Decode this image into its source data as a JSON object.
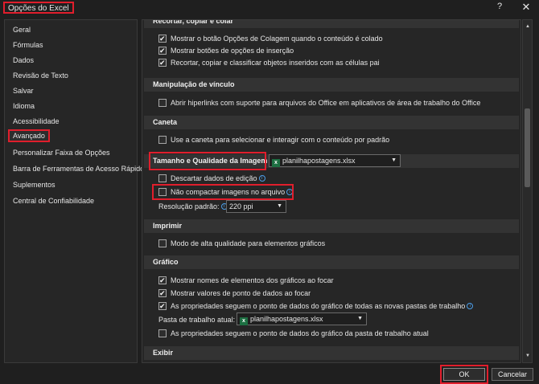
{
  "window": {
    "title": "Opções do Excel",
    "help_label": "?",
    "close_label": "✕"
  },
  "sidebar": {
    "items": [
      {
        "label": "Geral"
      },
      {
        "label": "Fórmulas"
      },
      {
        "label": "Dados"
      },
      {
        "label": "Revisão de Texto"
      },
      {
        "label": "Salvar"
      },
      {
        "label": "Idioma"
      },
      {
        "label": "Acessibilidade"
      },
      {
        "label": "Avançado"
      },
      {
        "label": "Personalizar Faixa de Opções"
      },
      {
        "label": "Barra de Ferramentas de Acesso Rápido"
      },
      {
        "label": "Suplementos"
      },
      {
        "label": "Central de Confiabilidade"
      }
    ],
    "active": "Avançado"
  },
  "content": {
    "cut_section": {
      "header": "Recortar, copiar e colar",
      "options": [
        {
          "label": "Mostrar o botão Opções de Colagem quando o conteúdo é colado",
          "checked": true
        },
        {
          "label": "Mostrar botões de opções de inserção",
          "checked": true
        },
        {
          "label": "Recortar, copiar e classificar objetos inseridos com as células pai",
          "checked": true
        }
      ]
    },
    "link_section": {
      "header": "Manipulação de vínculo",
      "options": [
        {
          "label": "Abrir hiperlinks com suporte para arquivos do Office em aplicativos de área de trabalho do Office",
          "checked": false
        }
      ]
    },
    "pen_section": {
      "header": "Caneta",
      "options": [
        {
          "label": "Use a caneta para selecionar e interagir com o conteúdo por padrão",
          "checked": false
        }
      ]
    },
    "image_section": {
      "header": "Tamanho e Qualidade da Imagem",
      "file_select": "planilhapostagens.xlsx",
      "options": [
        {
          "label": "Descartar dados de edição",
          "checked": false
        },
        {
          "label": "Não compactar imagens no arquivo",
          "checked": false
        }
      ],
      "resolution_label": "Resolução padrão:",
      "resolution_value": "220 ppi"
    },
    "print_section": {
      "header": "Imprimir",
      "options": [
        {
          "label": "Modo de alta qualidade para elementos gráficos",
          "checked": false
        }
      ]
    },
    "chart_section": {
      "header": "Gráfico",
      "options": [
        {
          "label": "Mostrar nomes de elementos dos gráficos ao focar",
          "checked": true
        },
        {
          "label": "Mostrar valores de ponto de dados ao focar",
          "checked": true
        },
        {
          "label": "As propriedades seguem o ponto de dados do gráfico de todas as novas pastas de trabalho",
          "checked": true
        },
        {
          "label": "As propriedades seguem o ponto de dados do gráfico da pasta de trabalho atual",
          "checked": false
        }
      ],
      "workbook_label": "Pasta de trabalho atual:",
      "workbook_value": "planilhapostagens.xlsx"
    },
    "display_section": {
      "header": "Exibir"
    }
  },
  "footer": {
    "ok_label": "OK",
    "cancel_label": "Cancelar"
  },
  "colors": {
    "highlight": "#e01e2c",
    "background": "#1f1f1f",
    "excel_green": "#1d6f42"
  }
}
